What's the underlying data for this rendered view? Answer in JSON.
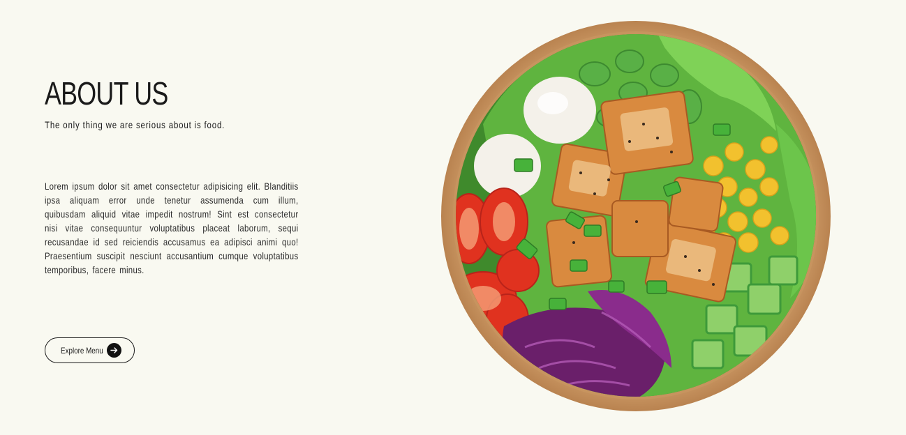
{
  "about": {
    "title": "ABOUT US",
    "subtitle": "The only thing we are serious about is food.",
    "body": "Lorem ipsum dolor sit amet consectetur adipisicing elit. Blanditiis ipsa aliquam error unde tenetur assumenda cum illum, quibusdam aliquid vitae impedit nostrum! Sint est consectetur nisi vitae consequuntur voluptatibus placeat laborum, sequi recusandae id sed reiciendis accusamus ea adipisci animi quo! Praesentium suscipit nesciunt accusantium cumque voluptatibus temporibus, facere minus."
  },
  "cta": {
    "label": "Explore Menu",
    "icon": "arrow-right-icon"
  },
  "image": {
    "subject": "salad-bowl-image"
  },
  "colors": {
    "background": "#f9f9f1",
    "text": "#1b1b1b",
    "button_icon_bg": "#111111"
  }
}
